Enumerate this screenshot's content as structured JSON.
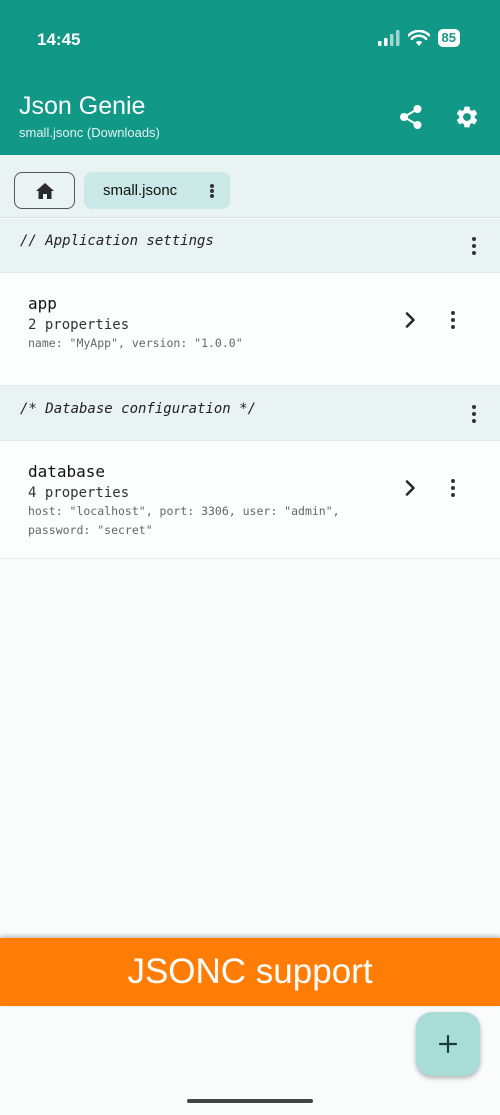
{
  "status_bar": {
    "time": "14:45",
    "battery": "85"
  },
  "app_bar": {
    "title": "Json Genie",
    "subtitle": "small.jsonc (Downloads)",
    "share_icon": "share-icon",
    "settings_icon": "gear-icon"
  },
  "breadcrumb": {
    "home_icon": "home-icon",
    "file_label": "small.jsonc"
  },
  "entries": [
    {
      "comment": "// Application settings",
      "name": "app",
      "count": "2 properties",
      "preview": "name: \"MyApp\", version: \"1.0.0\""
    },
    {
      "comment": "/* Database configuration */",
      "name": "database",
      "count": "4 properties",
      "preview": "host: \"localhost\", port: 3306, user: \"admin\", password: \"secret\""
    }
  ],
  "banner": {
    "text": "JSONC support"
  },
  "fab": {
    "icon": "plus-icon"
  },
  "colors": {
    "primary": "#119887",
    "banner": "#ff7c05",
    "fab": "#a8dcd7",
    "chip": "#c9e8e6"
  }
}
